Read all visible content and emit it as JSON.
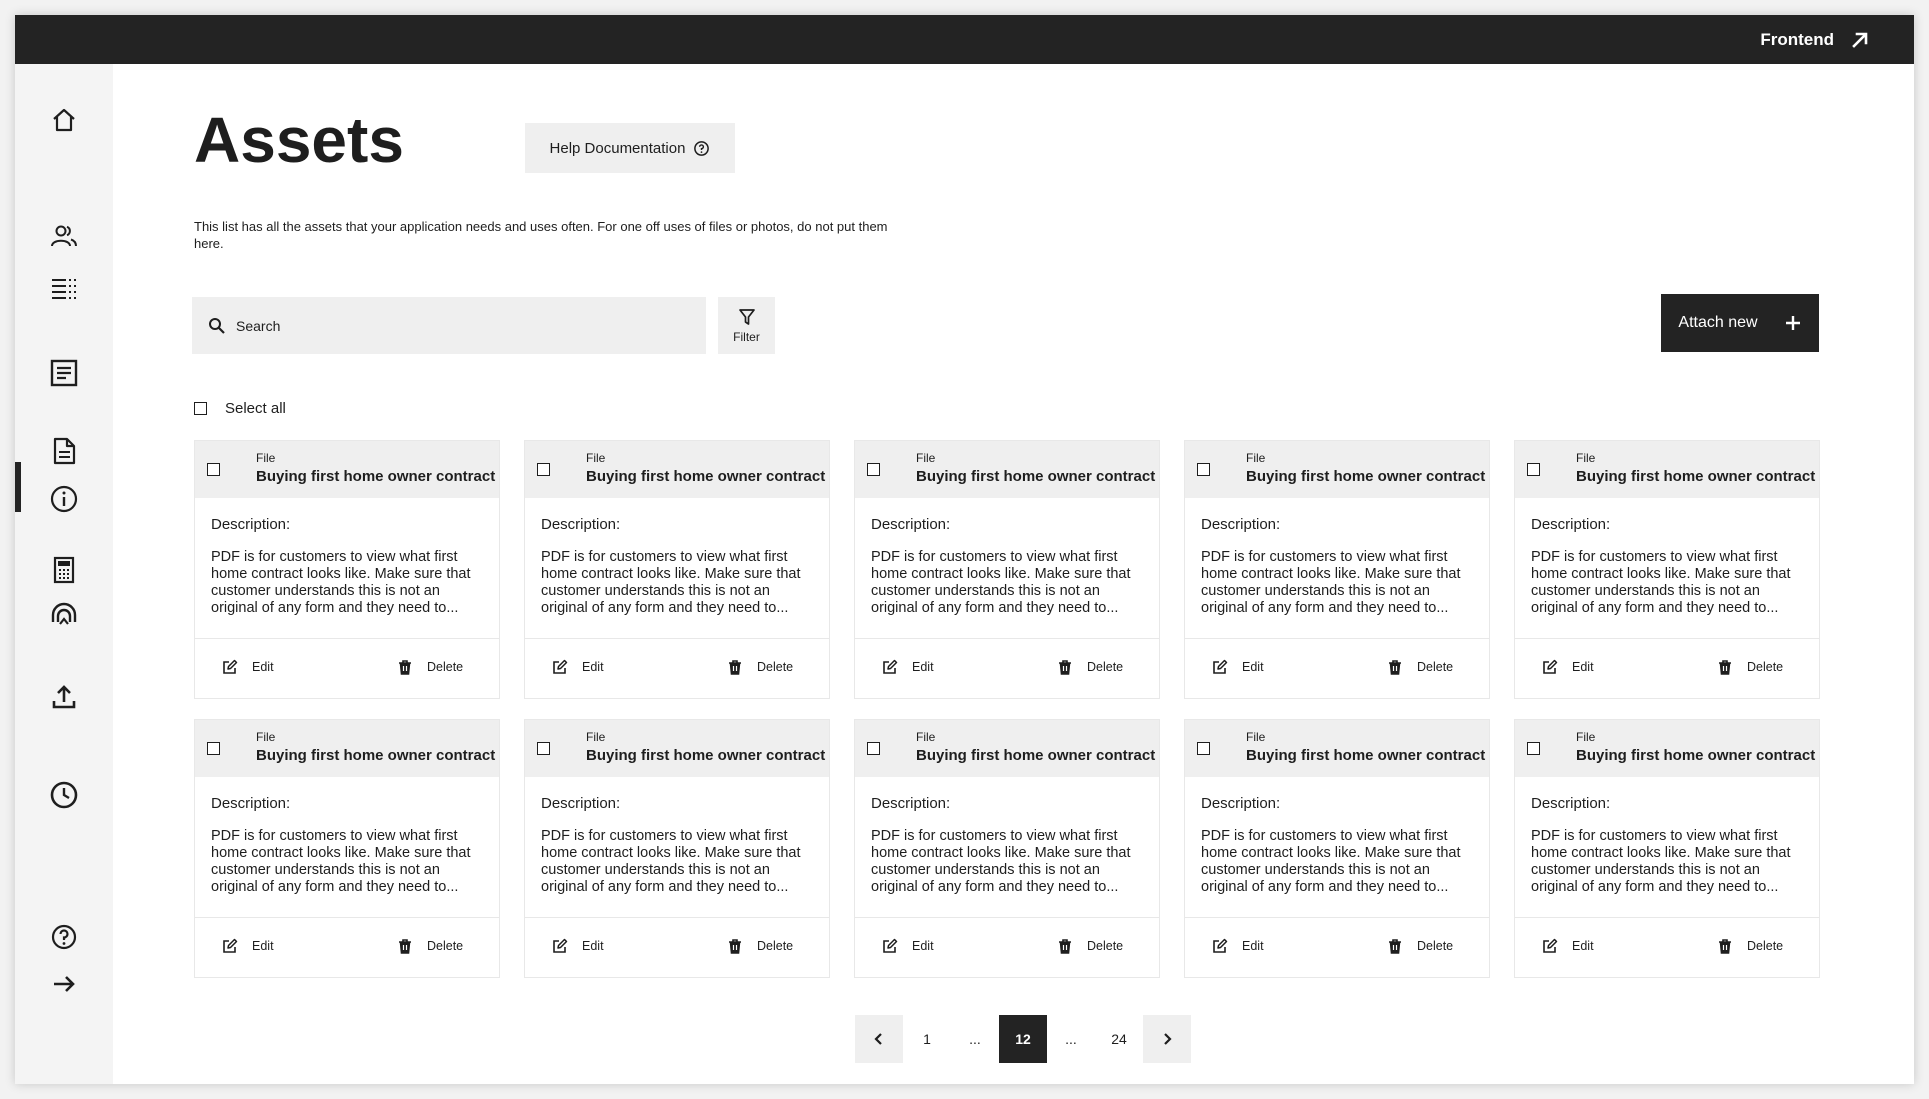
{
  "header": {
    "frontend_label": "Frontend",
    "frontend_icon": "arrow-up-right-icon"
  },
  "sidebar": {
    "items": [
      {
        "name": "home",
        "icon": "home-icon"
      },
      {
        "name": "users",
        "icon": "users-icon"
      },
      {
        "name": "list",
        "icon": "list-icon"
      },
      {
        "name": "article",
        "icon": "article-icon"
      },
      {
        "name": "document",
        "icon": "document-icon",
        "active": true
      },
      {
        "name": "info",
        "icon": "info-icon"
      },
      {
        "name": "calculator",
        "icon": "calculator-icon"
      },
      {
        "name": "support",
        "icon": "support-icon"
      },
      {
        "name": "upload",
        "icon": "upload-icon"
      },
      {
        "name": "history",
        "icon": "clock-icon"
      },
      {
        "name": "help",
        "icon": "help-icon"
      },
      {
        "name": "logout",
        "icon": "arrow-right-icon"
      }
    ]
  },
  "main": {
    "title": "Assets",
    "help_label": "Help Documentation",
    "description": "This list has all the assets that your application needs and uses often. For one off uses of files or photos, do not put them here.",
    "search": {
      "placeholder": "Search"
    },
    "filter_label": "Filter",
    "attach_label": "Attach new",
    "select_all_label": "Select all"
  },
  "cards": [
    {
      "type": "File",
      "title": "Buying first home owner contract",
      "desc_label": "Description:",
      "desc": "PDF is for customers to view what first home contract looks like. Make sure that customer understands this is not an original of any form and they need to...",
      "edit": "Edit",
      "delete": "Delete"
    },
    {
      "type": "File",
      "title": "Buying first home owner contract",
      "desc_label": "Description:",
      "desc": "PDF is for customers to view what first home contract looks like. Make sure that customer understands this is not an original of any form and they need to...",
      "edit": "Edit",
      "delete": "Delete"
    },
    {
      "type": "File",
      "title": "Buying first home owner contract",
      "desc_label": "Description:",
      "desc": "PDF is for customers to view what first home contract looks like. Make sure that customer understands this is not an original of any form and they need to...",
      "edit": "Edit",
      "delete": "Delete"
    },
    {
      "type": "File",
      "title": "Buying first home owner contract",
      "desc_label": "Description:",
      "desc": "PDF is for customers to view what first home contract looks like. Make sure that customer understands this is not an original of any form and they need to...",
      "edit": "Edit",
      "delete": "Delete"
    },
    {
      "type": "File",
      "title": "Buying first home owner contract",
      "desc_label": "Description:",
      "desc": "PDF is for customers to view what first home contract looks like. Make sure that customer understands this is not an original of any form and they need to...",
      "edit": "Edit",
      "delete": "Delete"
    },
    {
      "type": "File",
      "title": "Buying first home owner contract",
      "desc_label": "Description:",
      "desc": "PDF is for customers to view what first home contract looks like. Make sure that customer understands this is not an original of any form and they need to...",
      "edit": "Edit",
      "delete": "Delete"
    },
    {
      "type": "File",
      "title": "Buying first home owner contract",
      "desc_label": "Description:",
      "desc": "PDF is for customers to view what first home contract looks like. Make sure that customer understands this is not an original of any form and they need to...",
      "edit": "Edit",
      "delete": "Delete"
    },
    {
      "type": "File",
      "title": "Buying first home owner contract",
      "desc_label": "Description:",
      "desc": "PDF is for customers to view what first home contract looks like. Make sure that customer understands this is not an original of any form and they need to...",
      "edit": "Edit",
      "delete": "Delete"
    },
    {
      "type": "File",
      "title": "Buying first home owner contract",
      "desc_label": "Description:",
      "desc": "PDF is for customers to view what first home contract looks like. Make sure that customer understands this is not an original of any form and they need to...",
      "edit": "Edit",
      "delete": "Delete"
    },
    {
      "type": "File",
      "title": "Buying first home owner contract",
      "desc_label": "Description:",
      "desc": "PDF is for customers to view what first home contract looks like. Make sure that customer understands this is not an original of any form and they need to...",
      "edit": "Edit",
      "delete": "Delete"
    }
  ],
  "pagination": {
    "pages": [
      "1",
      "...",
      "12",
      "...",
      "24"
    ],
    "current": "12"
  }
}
